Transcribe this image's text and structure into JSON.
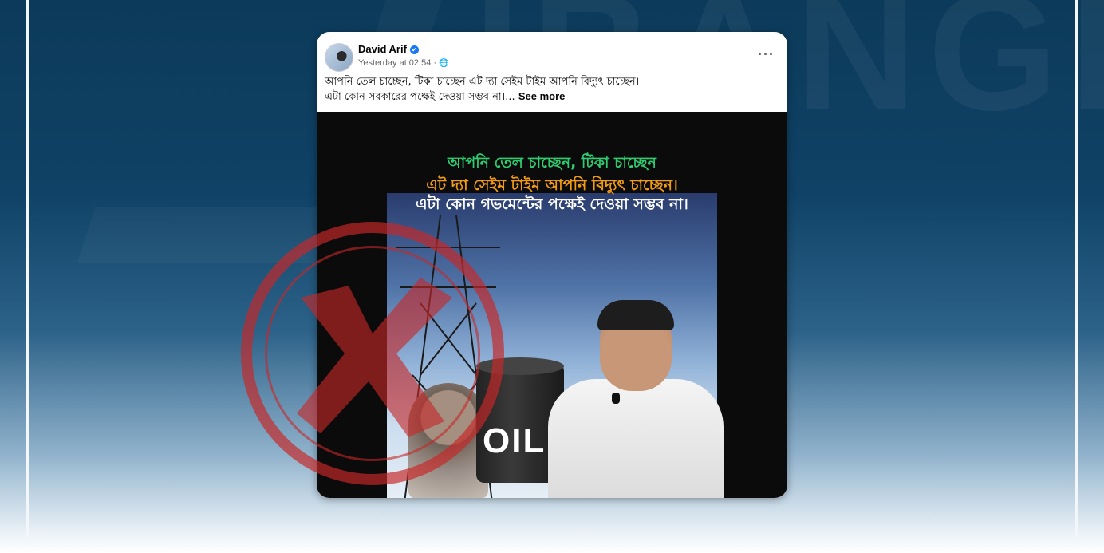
{
  "post": {
    "author": "David Arif",
    "timestamp": "Yesterday at 02:54 ·",
    "more_icon": "···",
    "caption_line1": "আপনি তেল চাচ্ছেন, টিকা চাচ্ছেন এট দ্যা সেইম টাইম আপনি বিদ্যুৎ চাচ্ছেন।",
    "caption_line2": "এটা কোন সরকারের পক্ষেই দেওয়া সম্ভব না।...",
    "see_more": "See more"
  },
  "image": {
    "line1": "আপনি তেল চাচ্ছেন, টিকা চাচ্ছেন",
    "line2": "এট দ্যা সেইম টাইম আপনি বিদ্যুৎ চাচ্ছেন।",
    "line3": "এটা কোন গভমেন্টের পক্ষেই দেওয়া সম্ভব না।",
    "barrel_label": "OIL"
  },
  "colors": {
    "line1": "#2ecc71",
    "line2": "#f39c12",
    "line3": "#ffffff",
    "stamp": "#c62828",
    "verified": "#1877f2"
  },
  "icons": {
    "verified": "verified-badge-icon",
    "globe": "globe-icon",
    "more": "more-options-icon",
    "stamp": "false-x-stamp-icon"
  }
}
